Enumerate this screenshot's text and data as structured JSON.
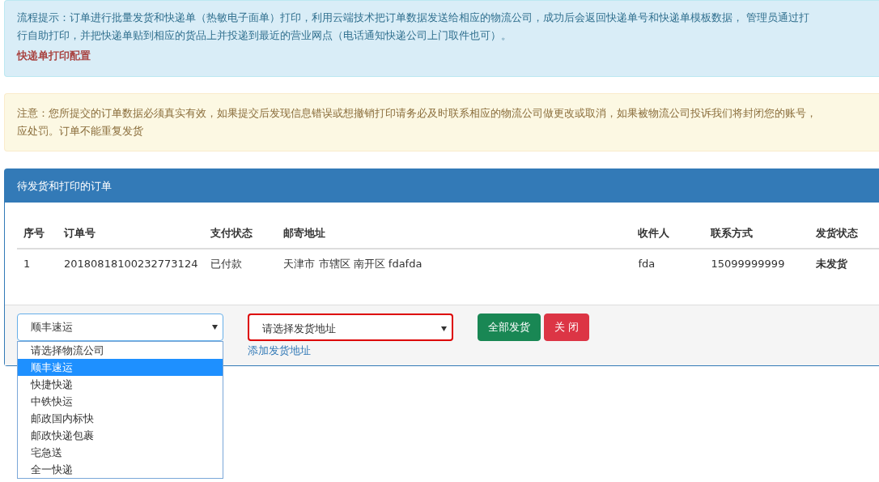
{
  "info_alert": {
    "lines": [
      "流程提示：订单进行批量发货和快递单（热敏电子面单）打印，利用云端技术把订单数据发送给相应的物流公司，成功后会返回快递单号和快递单模板数据， 管理员通过打",
      "行自助打印，并把快递单贴到相应的货品上并投递到最近的营业网点（电话通知快递公司上门取件也可）。"
    ],
    "link": "快递单打印配置"
  },
  "warning_alert": {
    "lines": [
      "注意：您所提交的订单数据必须真实有效，如果提交后发现信息错误或想撤销打印请务必及时联系相应的物流公司做更改或取消，如果被物流公司投诉我们将封闭您的账号，",
      "应处罚。订单不能重复发货"
    ]
  },
  "panel": {
    "title": "待发货和打印的订单",
    "table": {
      "columns": [
        "序号",
        "订单号",
        "支付状态",
        "邮寄地址",
        "收件人",
        "联系方式",
        "发货状态"
      ],
      "rows": [
        [
          "1",
          "20180818100232773124",
          "已付款",
          "天津市 市辖区 南开区 fdafda",
          "fda",
          "15099999999",
          "未发货"
        ]
      ]
    },
    "carrier_select": {
      "value": "顺丰速运",
      "expanded": true,
      "options": [
        {
          "label": "请选择物流公司",
          "selected": false
        },
        {
          "label": "顺丰速运",
          "selected": true
        },
        {
          "label": "快捷快递",
          "selected": false
        },
        {
          "label": "中铁快运",
          "selected": false
        },
        {
          "label": "邮政国内标快",
          "selected": false
        },
        {
          "label": "邮政快递包裹",
          "selected": false
        },
        {
          "label": "宅急送",
          "selected": false
        },
        {
          "label": "全一快递",
          "selected": false
        }
      ]
    },
    "address_select": {
      "value": "请选择发货地址",
      "invalid": true
    },
    "add_address_link": "添加发货地址",
    "buttons": [
      {
        "label": "全部发货",
        "kind": "success"
      },
      {
        "label": "关 闭",
        "kind": "danger"
      }
    ]
  }
}
